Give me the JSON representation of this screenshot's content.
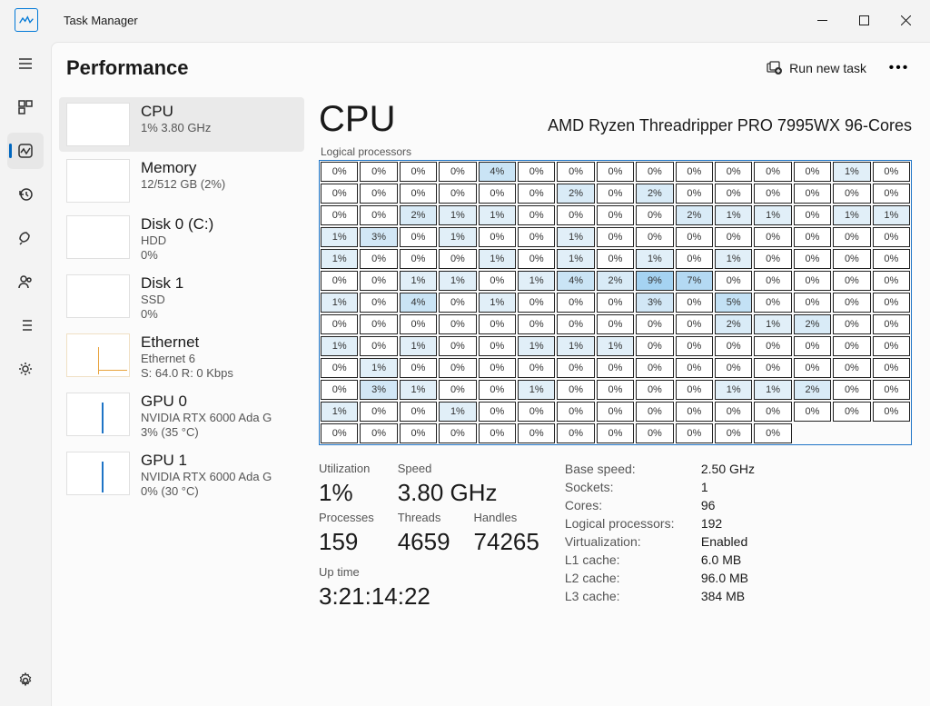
{
  "window": {
    "title": "Task Manager"
  },
  "header": {
    "title": "Performance",
    "run_task_label": "Run new task"
  },
  "rail": {
    "items": [
      {
        "id": "menu"
      },
      {
        "id": "processes"
      },
      {
        "id": "performance"
      },
      {
        "id": "history"
      },
      {
        "id": "startup"
      },
      {
        "id": "users"
      },
      {
        "id": "details"
      },
      {
        "id": "services"
      }
    ]
  },
  "devices": [
    {
      "name": "CPU",
      "line1": "1%  3.80 GHz",
      "line2": ""
    },
    {
      "name": "Memory",
      "line1": "12/512 GB (2%)",
      "line2": ""
    },
    {
      "name": "Disk 0 (C:)",
      "line1": "HDD",
      "line2": "0%"
    },
    {
      "name": "Disk 1",
      "line1": "SSD",
      "line2": "0%"
    },
    {
      "name": "Ethernet",
      "line1": "Ethernet 6",
      "line2": "S: 64.0  R: 0 Kbps"
    },
    {
      "name": "GPU 0",
      "line1": "NVIDIA RTX 6000 Ada G",
      "line2": "3% (35 °C)"
    },
    {
      "name": "GPU 1",
      "line1": "NVIDIA RTX 6000 Ada G",
      "line2": "0% (30 °C)"
    }
  ],
  "detail": {
    "title": "CPU",
    "model": "AMD Ryzen Threadripper PRO 7995WX 96-Cores",
    "lp_label": "Logical processors",
    "big": {
      "util_lbl": "Utilization",
      "util": "1%",
      "speed_lbl": "Speed",
      "speed": "3.80 GHz",
      "proc_lbl": "Processes",
      "proc": "159",
      "threads_lbl": "Threads",
      "threads": "4659",
      "handles_lbl": "Handles",
      "handles": "74265",
      "uptime_lbl": "Up time",
      "uptime": "3:21:14:22"
    },
    "small": [
      [
        "Base speed:",
        "2.50 GHz"
      ],
      [
        "Sockets:",
        "1"
      ],
      [
        "Cores:",
        "96"
      ],
      [
        "Logical processors:",
        "192"
      ],
      [
        "Virtualization:",
        "Enabled"
      ],
      [
        "L1 cache:",
        "6.0 MB"
      ],
      [
        "L2 cache:",
        "96.0 MB"
      ],
      [
        "L3 cache:",
        "384 MB"
      ]
    ],
    "cores": [
      0,
      0,
      0,
      0,
      4,
      0,
      0,
      0,
      0,
      0,
      0,
      0,
      0,
      1,
      0,
      0,
      0,
      0,
      0,
      0,
      0,
      2,
      0,
      2,
      0,
      0,
      0,
      0,
      0,
      0,
      0,
      0,
      2,
      1,
      1,
      0,
      0,
      0,
      0,
      2,
      1,
      1,
      0,
      1,
      1,
      1,
      3,
      0,
      1,
      0,
      0,
      1,
      0,
      0,
      0,
      0,
      0,
      0,
      0,
      0,
      1,
      0,
      0,
      0,
      1,
      0,
      1,
      0,
      1,
      0,
      1,
      0,
      0,
      0,
      0,
      0,
      0,
      1,
      1,
      0,
      1,
      4,
      2,
      9,
      7,
      0,
      0,
      0,
      0,
      0,
      1,
      0,
      4,
      0,
      1,
      0,
      0,
      0,
      3,
      0,
      5,
      0,
      0,
      0,
      0,
      0,
      0,
      0,
      0,
      0,
      0,
      0,
      0,
      0,
      0,
      2,
      1,
      2,
      0,
      0,
      1,
      0,
      1,
      0,
      0,
      1,
      1,
      1,
      0,
      0,
      0,
      0,
      0,
      0,
      0,
      0,
      1,
      0,
      0,
      0,
      0,
      0,
      0,
      0,
      0,
      0,
      0,
      0,
      0,
      0,
      0,
      3,
      1,
      0,
      0,
      1,
      0,
      0,
      0,
      0,
      1,
      1,
      2,
      0,
      0,
      1,
      0,
      0,
      1,
      0,
      0,
      0,
      0,
      0,
      0,
      0,
      0,
      0,
      0,
      0,
      0,
      0,
      0,
      0,
      0,
      0,
      0,
      0,
      0,
      0,
      0,
      0
    ]
  }
}
